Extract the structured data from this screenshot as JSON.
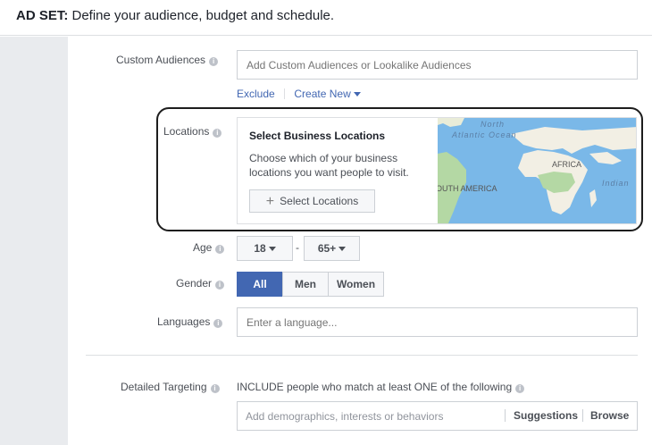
{
  "header": {
    "prefix": "AD SET:",
    "text": " Define your audience, budget and schedule",
    "suffix": "."
  },
  "custom_audiences": {
    "label": "Custom Audiences",
    "placeholder": "Add Custom Audiences or Lookalike Audiences",
    "exclude": "Exclude",
    "create_new": "Create New"
  },
  "locations": {
    "label": "Locations",
    "title": "Select Business Locations",
    "description": "Choose which of your business locations you want people to visit.",
    "button": "Select Locations",
    "map_labels": {
      "north": "North",
      "atlantic": "Atlantic Ocean",
      "africa": "AFRICA",
      "south_america": "SOUTH AMERICA",
      "indian": "Indian"
    }
  },
  "age": {
    "label": "Age",
    "min": "18",
    "max": "65+",
    "separator": "-"
  },
  "gender": {
    "label": "Gender",
    "options": [
      "All",
      "Men",
      "Women"
    ],
    "selected": "All"
  },
  "languages": {
    "label": "Languages",
    "placeholder": "Enter a language..."
  },
  "detailed_targeting": {
    "label": "Detailed Targeting",
    "include_text": "INCLUDE people who match at least ONE of the following",
    "placeholder": "Add demographics, interests or behaviors",
    "suggestions": "Suggestions",
    "browse": "Browse"
  },
  "colors": {
    "accent": "#4267b2",
    "ocean": "#7ab8e8",
    "land": "#f2efe4",
    "green": "#b4d8a4"
  }
}
